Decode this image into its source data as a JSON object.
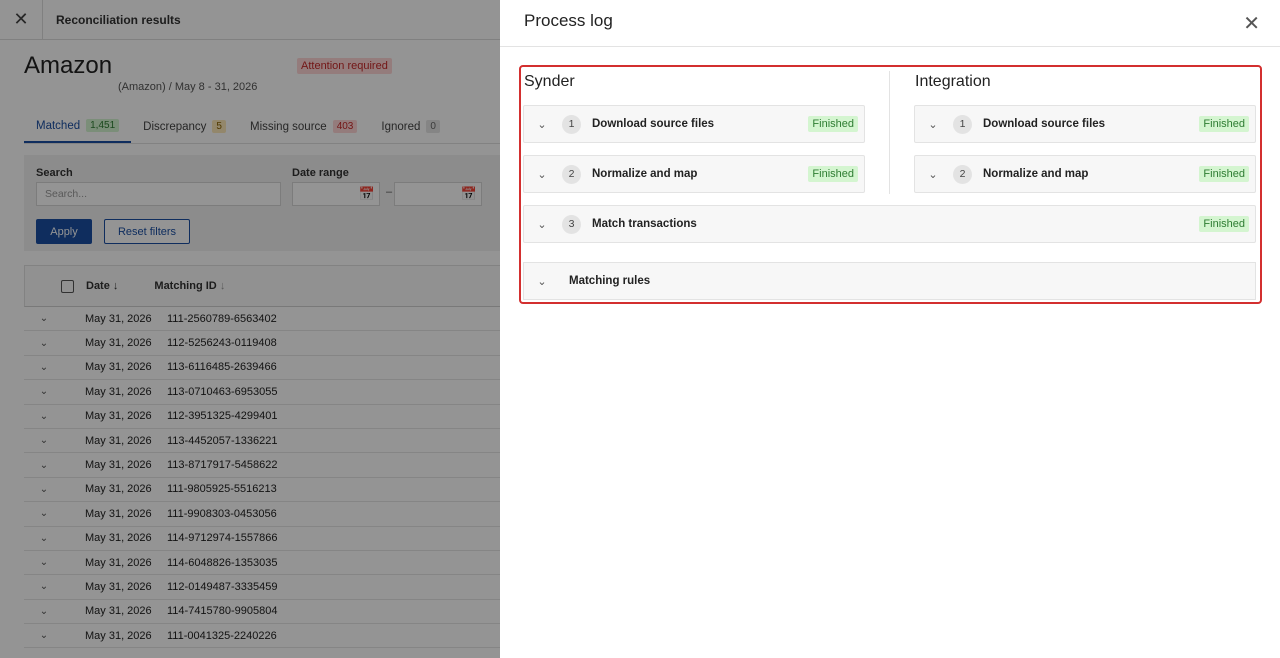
{
  "topbar": {
    "title": "Reconciliation results"
  },
  "header": {
    "vendor": "Amazon",
    "subtitle": "(Amazon) / May 8 - 31, 2026",
    "attention": "Attention required"
  },
  "tabs": [
    {
      "label": "Matched",
      "count": "1,451",
      "color": "green"
    },
    {
      "label": "Discrepancy",
      "count": "5",
      "color": "yellow"
    },
    {
      "label": "Missing source",
      "count": "403",
      "color": "red"
    },
    {
      "label": "Ignored",
      "count": "0",
      "color": "grey"
    }
  ],
  "filters": {
    "search_label": "Search",
    "search_placeholder": "Search...",
    "date_label": "Date range",
    "date_sep": "–",
    "apply": "Apply",
    "reset": "Reset filters"
  },
  "table": {
    "col_date": "Date",
    "col_matching": "Matching ID",
    "rows": [
      {
        "date": "May 31, 2026",
        "id": "111-2560789-6563402"
      },
      {
        "date": "May 31, 2026",
        "id": "112-5256243-0119408"
      },
      {
        "date": "May 31, 2026",
        "id": "113-6116485-2639466"
      },
      {
        "date": "May 31, 2026",
        "id": "113-0710463-6953055"
      },
      {
        "date": "May 31, 2026",
        "id": "112-3951325-4299401"
      },
      {
        "date": "May 31, 2026",
        "id": "113-4452057-1336221"
      },
      {
        "date": "May 31, 2026",
        "id": "113-8717917-5458622"
      },
      {
        "date": "May 31, 2026",
        "id": "111-9805925-5516213"
      },
      {
        "date": "May 31, 2026",
        "id": "111-9908303-0453056"
      },
      {
        "date": "May 31, 2026",
        "id": "114-9712974-1557866"
      },
      {
        "date": "May 31, 2026",
        "id": "114-6048826-1353035"
      },
      {
        "date": "May 31, 2026",
        "id": "112-0149487-3335459"
      },
      {
        "date": "May 31, 2026",
        "id": "114-7415780-9905804"
      },
      {
        "date": "May 31, 2026",
        "id": "111-0041325-2240226"
      }
    ]
  },
  "drawer": {
    "title": "Process log",
    "synder": {
      "title": "Synder",
      "steps": [
        {
          "num": "1",
          "name": "Download source files",
          "status": "Finished"
        },
        {
          "num": "2",
          "name": "Normalize and map",
          "status": "Finished"
        }
      ]
    },
    "integration": {
      "title": "Integration",
      "steps": [
        {
          "num": "1",
          "name": "Download source files",
          "status": "Finished"
        },
        {
          "num": "2",
          "name": "Normalize and map",
          "status": "Finished"
        }
      ]
    },
    "match": {
      "num": "3",
      "name": "Match transactions",
      "status": "Finished"
    },
    "rules": {
      "name": "Matching rules"
    }
  }
}
